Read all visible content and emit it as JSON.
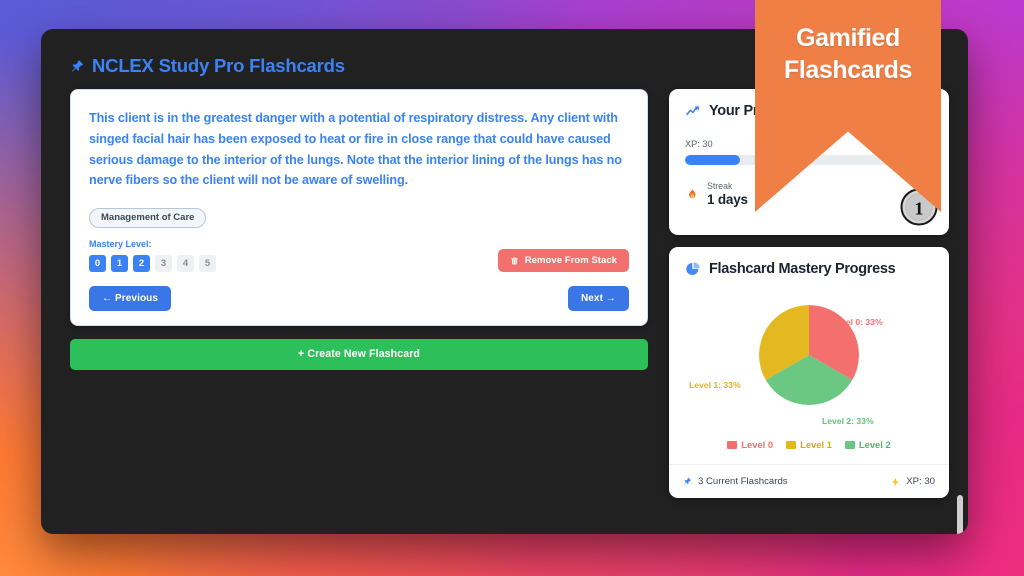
{
  "app": {
    "title": "NCLEX Study Pro Flashcards",
    "pin_icon": "pin-icon"
  },
  "banner": {
    "line1": "Gamified",
    "line2": "Flashcards",
    "color": "#ef7f45"
  },
  "flashcard": {
    "text": "This client is in the greatest danger with a potential of respiratory distress. Any client with singed facial hair has been exposed to heat or fire in close range that could have caused serious damage to the interior of the lungs. Note that the interior lining of the lungs has no nerve fibers so the client will not be aware of swelling.",
    "tag": "Management of Care",
    "mastery_label": "Mastery Level:",
    "mastery_levels": [
      {
        "value": "0",
        "active": true
      },
      {
        "value": "1",
        "active": true
      },
      {
        "value": "2",
        "active": true
      },
      {
        "value": "3",
        "active": false
      },
      {
        "value": "4",
        "active": false
      },
      {
        "value": "5",
        "active": false
      }
    ],
    "remove_label": "Remove From Stack",
    "remove_icon": "trash-icon",
    "prev_label": "←  Previous",
    "next_label": "Next  →",
    "create_label": "+  Create New Flashcard"
  },
  "progress": {
    "title": "Your Progress",
    "title_icon": "chart-line-icon",
    "xp_label": "XP: 30",
    "xp_percent": 22,
    "streak_label": "Streak",
    "streak_value": "1 days",
    "streak_icon": "flame-icon",
    "level_badge": "1"
  },
  "mastery_panel": {
    "title": "Flashcard Mastery Progress",
    "title_icon": "pie-chart-icon",
    "footer_cards": "3 Current Flashcards",
    "footer_xp": "XP: 30",
    "footer_cards_icon": "pin-icon",
    "footer_xp_icon": "bolt-icon"
  },
  "chart_data": {
    "type": "pie",
    "title": "Flashcard Mastery Progress",
    "categories": [
      "Level 0",
      "Level 1",
      "Level 2"
    ],
    "values": [
      33,
      33,
      33
    ],
    "labels": [
      "Level 0: 33%",
      "Level 1: 33%",
      "Level 2: 33%"
    ],
    "colors": [
      "#f4706e",
      "#e3b820",
      "#6ac883"
    ],
    "legend": [
      "Level 0",
      "Level 1",
      "Level 2"
    ],
    "legend_position": "bottom",
    "total_items": 3,
    "unit": "%"
  }
}
